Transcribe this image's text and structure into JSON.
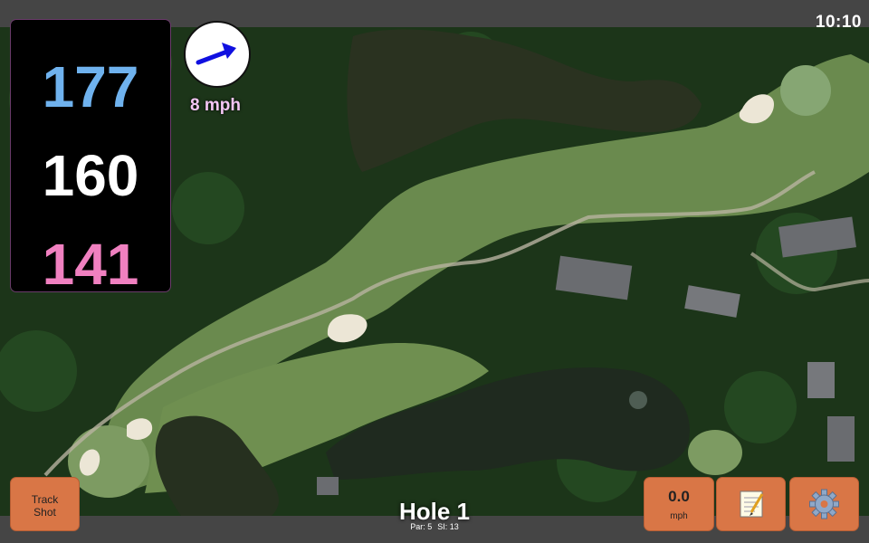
{
  "status": {
    "time": "10:10"
  },
  "distances": {
    "back": "177",
    "middle": "160",
    "front": "141"
  },
  "wind": {
    "speed": "8 mph",
    "icon": "arrow-icon",
    "color": "#1010e0"
  },
  "buttons": {
    "track_line1": "Track",
    "track_line2": "Shot",
    "speed_value": "0.0",
    "speed_unit": "mph",
    "notes_icon": "notepad-icon",
    "settings_icon": "gear-icon"
  },
  "hole": {
    "title": "Hole 1",
    "par": "Par: 5",
    "si": "SI: 13"
  },
  "colors": {
    "button": "#d97646",
    "back": "#6fb2ee",
    "front": "#f080c0",
    "wind_text": "#f4c6f4"
  }
}
